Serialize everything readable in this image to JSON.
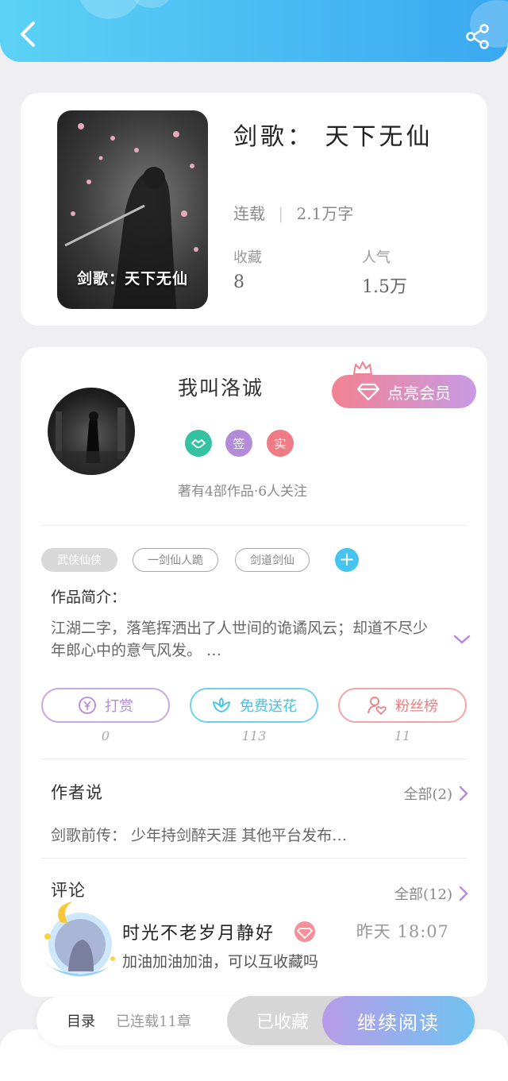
{
  "colors": {
    "header_gradient": [
      "#5bd2f5",
      "#3aa8f0"
    ],
    "accent_blue": "#44c4ef",
    "reward_purple": "#b48bd9",
    "flower_cyan": "#3fc4e6",
    "fans_red": "#ef7c84",
    "vip_gradient": [
      "#f28290",
      "#c79be6"
    ]
  },
  "header": {
    "back_icon": "chevron-left-icon",
    "share_icon": "share-icon"
  },
  "book": {
    "cover_title": "剑歌：天下无仙",
    "title": "剑歌： 天下无仙",
    "status": "连载",
    "word_count": "2.1万字",
    "stats": [
      {
        "label": "收藏",
        "value": "8"
      },
      {
        "label": "人气",
        "value": "1.5万"
      }
    ]
  },
  "author": {
    "name": "我叫洛诚",
    "vip_button": "点亮会员",
    "badges": [
      {
        "icon": "handshake-icon",
        "text": "",
        "color": "#34c2a0"
      },
      {
        "icon": "sign-badge-icon",
        "text": "签",
        "color": "#b48bd9"
      },
      {
        "icon": "verified-badge-icon",
        "text": "实",
        "color": "#ef7c84"
      }
    ],
    "stats_text": "著有4部作品·6人关注"
  },
  "tags": [
    "武侠仙侠",
    "一剑仙人跪",
    "剑道剑仙"
  ],
  "intro": {
    "label": "作品简介：",
    "text": "江湖二字，落笔挥洒出了人世间的诡谲风云；却道不尽少年郎心中的意气风发。 …"
  },
  "actions": [
    {
      "label": "打赏",
      "icon": "yen-coin-icon",
      "count": "0"
    },
    {
      "label": "免费送花",
      "icon": "flower-icon",
      "count": "113"
    },
    {
      "label": "粉丝榜",
      "icon": "fan-heart-icon",
      "count": "11"
    }
  ],
  "author_say": {
    "title": "作者说",
    "more": "全部(2)",
    "text": "剑歌前传： 少年持剑醉天涯 其他平台发布…"
  },
  "comments": {
    "title": "评论",
    "more": "全部(12)",
    "items": [
      {
        "user": "时光不老岁月静好",
        "time": "昨天 18:07",
        "text": "加油加油加油，可以互收藏吗"
      }
    ]
  },
  "bottom_bar": {
    "catalog": "目录",
    "chapters": "已连载11章",
    "collected": "已收藏",
    "read": "继续阅读"
  }
}
